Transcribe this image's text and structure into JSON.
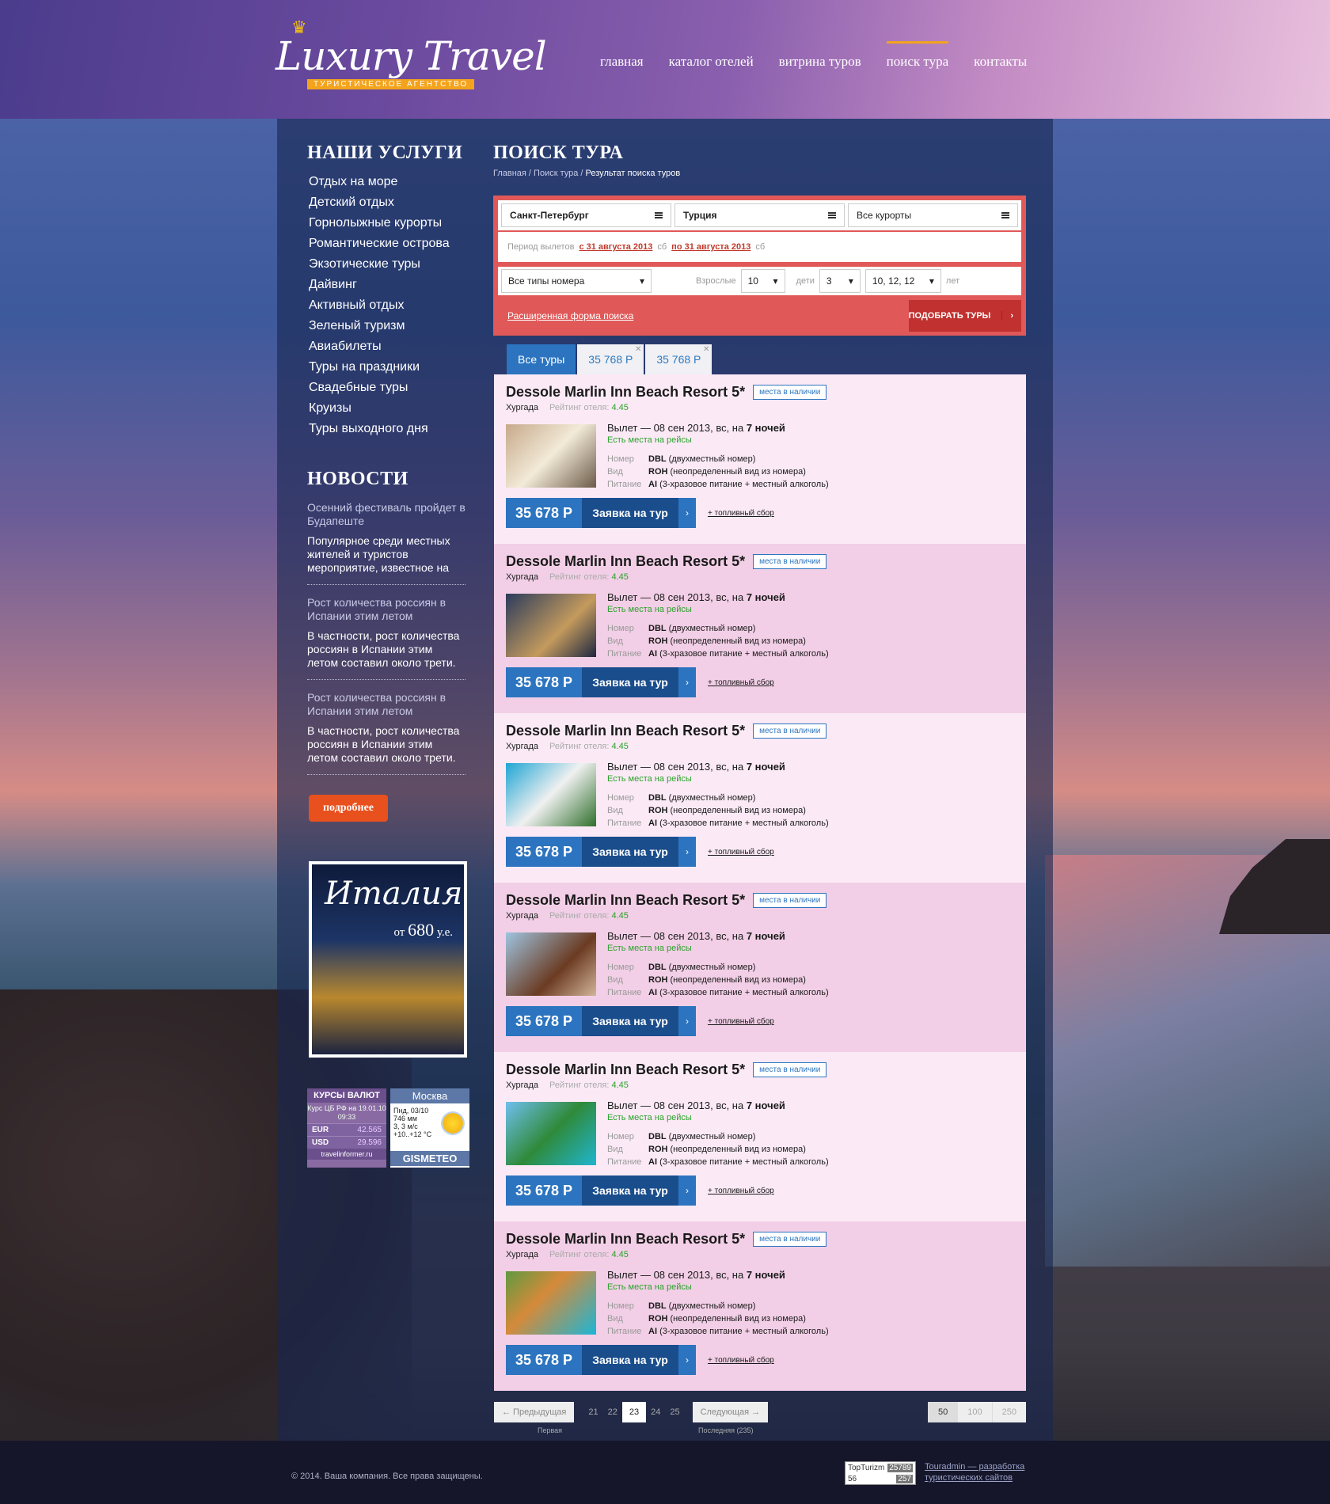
{
  "header": {
    "logo_text": "Luxury Travel",
    "logo_tagline": "ТУРИСТИЧЕСКОЕ АГЕНТСТВО",
    "nav": [
      "главная",
      "каталог отелей",
      "витрина туров",
      "поиск тура",
      "контакты"
    ],
    "nav_active": "поиск тура"
  },
  "sidebar": {
    "services_title": "НАШИ УСЛУГИ",
    "services": [
      "Отдых на море",
      "Детский отдых",
      "Горнолыжные курорты",
      "Романтические острова",
      "Экзотические туры",
      "Дайвинг",
      "Активный отдых",
      "Зеленый туризм",
      "Авиабилеты",
      "Туры на праздники",
      "Свадебные туры",
      "Круизы",
      "Туры выходного дня"
    ],
    "news_title": "НОВОСТИ",
    "news": [
      {
        "title": "Осенний фестиваль пройдет в Будапеште",
        "text": "Популярное среди местных жителей и туристов мероприятие, известное на"
      },
      {
        "title": "Рост количества россиян в Испании этим летом",
        "text": "В частности, рост количества россиян в Испании этим летом составил около трети."
      },
      {
        "title": "Рост количества россиян в Испании этим летом",
        "text": "В частности, рост количества россиян в Испании этим летом составил около трети."
      }
    ],
    "more_button": "подробнее",
    "promo": {
      "title": "Италия",
      "price_prefix": "от",
      "price": "680",
      "price_unit": "у.е."
    },
    "currency": {
      "title": "КУРСЫ ВАЛЮТ",
      "subtitle": "Курс ЦБ РФ на 19.01.10 09:33",
      "rows": [
        {
          "code": "EUR",
          "value": "42.565"
        },
        {
          "code": "USD",
          "value": "29.596"
        }
      ],
      "footer": "travelinformer.ru"
    },
    "weather": {
      "city": "Москва",
      "lines": [
        "Пнд, 03/10",
        "746 мм",
        "3, 3 м/с",
        "+10..+12 °C"
      ],
      "brand": "GISMETEO"
    }
  },
  "content": {
    "title": "ПОИСК ТУРА",
    "breadcrumb": [
      "Главная",
      "Поиск тура",
      "Результат поиска туров"
    ],
    "search": {
      "from": "Санкт-Петербург",
      "country": "Турция",
      "resorts": "Все курорты",
      "period_label": "Период вылетов",
      "date_from": "с 31 августа 2013",
      "date_from_day": "сб",
      "date_to": "по 31 августа 2013",
      "date_to_day": "сб",
      "room_type": "Все типы номера",
      "adults_label": "Взрослые",
      "adults": "10",
      "children_label": "дети",
      "children": "3",
      "children_ages": "10, 12, 12",
      "years_label": "лет",
      "advanced_link": "Расширенная форма поиска",
      "submit": "ПОДОБРАТЬ ТУРЫ"
    },
    "tabs": [
      "Все туры",
      "35 768 Р",
      "35 768 Р"
    ],
    "results": [
      {
        "name": "Dessole Marlin Inn Beach Resort 5*",
        "badge": "места в наличии",
        "city": "Хургада",
        "rating_label": "Рейтинг отеля:",
        "rating": "4.45",
        "flight": "Вылет — 08 сен 2013, вс, на",
        "nights": "7 ночей",
        "avail": "Есть места на рейсы",
        "room_label": "Номер",
        "room_code": "DBL",
        "room": "(двухместный номер)",
        "view_label": "Вид",
        "view_code": "ROH",
        "view": "(неопределенный вид из номера)",
        "meal_label": "Питание",
        "meal_code": "AI",
        "meal": "(3-хразовое питание + местный алкоголь)",
        "price": "35 678 Р",
        "order": "Заявка на тур",
        "fuel": "+ топливный сбор"
      },
      {
        "name": "Dessole Marlin Inn Beach Resort 5*",
        "badge": "места в наличии",
        "city": "Хургада",
        "rating_label": "Рейтинг отеля:",
        "rating": "4.45",
        "flight": "Вылет — 08 сен 2013, вс, на",
        "nights": "7 ночей",
        "avail": "Есть места на рейсы",
        "room_label": "Номер",
        "room_code": "DBL",
        "room": "(двухместный номер)",
        "view_label": "Вид",
        "view_code": "ROH",
        "view": "(неопределенный вид из номера)",
        "meal_label": "Питание",
        "meal_code": "AI",
        "meal": "(3-хразовое питание + местный алкоголь)",
        "price": "35 678 Р",
        "order": "Заявка на тур",
        "fuel": "+ топливный сбор"
      },
      {
        "name": "Dessole Marlin Inn Beach Resort 5*",
        "badge": "места в наличии",
        "city": "Хургада",
        "rating_label": "Рейтинг отеля:",
        "rating": "4.45",
        "flight": "Вылет — 08 сен 2013, вс, на",
        "nights": "7 ночей",
        "avail": "Есть места на рейсы",
        "room_label": "Номер",
        "room_code": "DBL",
        "room": "(двухместный номер)",
        "view_label": "Вид",
        "view_code": "ROH",
        "view": "(неопределенный вид из номера)",
        "meal_label": "Питание",
        "meal_code": "AI",
        "meal": "(3-хразовое питание + местный алкоголь)",
        "price": "35 678 Р",
        "order": "Заявка на тур",
        "fuel": "+ топливный сбор"
      },
      {
        "name": "Dessole Marlin Inn Beach Resort 5*",
        "badge": "места в наличии",
        "city": "Хургада",
        "rating_label": "Рейтинг отеля:",
        "rating": "4.45",
        "flight": "Вылет — 08 сен 2013, вс, на",
        "nights": "7 ночей",
        "avail": "Есть места на рейсы",
        "room_label": "Номер",
        "room_code": "DBL",
        "room": "(двухместный номер)",
        "view_label": "Вид",
        "view_code": "ROH",
        "view": "(неопределенный вид из номера)",
        "meal_label": "Питание",
        "meal_code": "AI",
        "meal": "(3-хразовое питание + местный алкоголь)",
        "price": "35 678 Р",
        "order": "Заявка на тур",
        "fuel": "+ топливный сбор"
      },
      {
        "name": "Dessole Marlin Inn Beach Resort 5*",
        "badge": "места в наличии",
        "city": "Хургада",
        "rating_label": "Рейтинг отеля:",
        "rating": "4.45",
        "flight": "Вылет — 08 сен 2013, вс, на",
        "nights": "7 ночей",
        "avail": "Есть места на рейсы",
        "room_label": "Номер",
        "room_code": "DBL",
        "room": "(двухместный номер)",
        "view_label": "Вид",
        "view_code": "ROH",
        "view": "(неопределенный вид из номера)",
        "meal_label": "Питание",
        "meal_code": "AI",
        "meal": "(3-хразовое питание + местный алкоголь)",
        "price": "35 678 Р",
        "order": "Заявка на тур",
        "fuel": "+ топливный сбор"
      },
      {
        "name": "Dessole Marlin Inn Beach Resort 5*",
        "badge": "места в наличии",
        "city": "Хургада",
        "rating_label": "Рейтинг отеля:",
        "rating": "4.45",
        "flight": "Вылет — 08 сен 2013, вс, на",
        "nights": "7 ночей",
        "avail": "Есть места на рейсы",
        "room_label": "Номер",
        "room_code": "DBL",
        "room": "(двухместный номер)",
        "view_label": "Вид",
        "view_code": "ROH",
        "view": "(неопределенный вид из номера)",
        "meal_label": "Питание",
        "meal_code": "AI",
        "meal": "(3-хразовое питание + местный алкоголь)",
        "price": "35 678 Р",
        "order": "Заявка на тур",
        "fuel": "+ топливный сбор"
      }
    ],
    "pager": {
      "prev": "← Предыдущая",
      "pages": [
        "21",
        "22",
        "23",
        "24",
        "25"
      ],
      "current": "23",
      "next": "Следующая →",
      "first_label": "Первая",
      "last_label": "Последняя (235)",
      "sizes": [
        "50",
        "100",
        "250"
      ],
      "size_active": "50"
    }
  },
  "footer": {
    "copyright": "© 2014. Ваша компания. Все права защищены.",
    "counter_name": "TopTurizm",
    "counter_a": "25789",
    "counter_b": "56",
    "counter_c": "257",
    "developer_line1": "Touradmin — разработка",
    "developer_line2": "туристических сайтов"
  },
  "colors": {
    "accent": "#2c74bf",
    "search_bg": "#e05958",
    "nav_active": "#f3a31c",
    "more_button": "#e8501d"
  }
}
